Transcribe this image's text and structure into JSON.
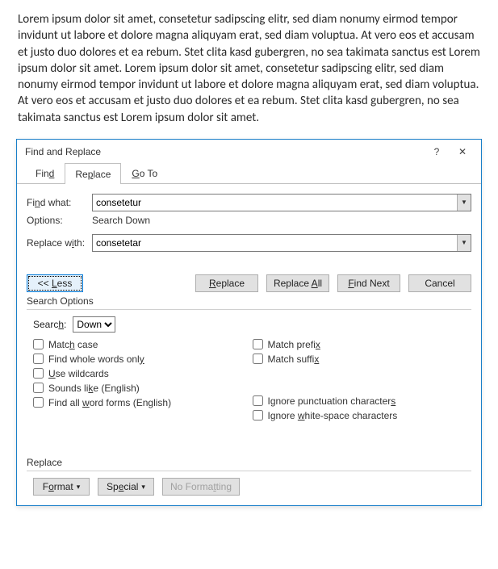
{
  "document": {
    "text": "Lorem ipsum dolor sit amet, consetetur sadipscing elitr, sed diam nonumy eirmod tempor invidunt ut labore et dolore magna aliquyam erat, sed diam voluptua. At vero eos et accusam et justo duo dolores et ea rebum. Stet clita kasd gubergren, no sea takimata sanctus est Lorem ipsum dolor sit amet. Lorem ipsum dolor sit amet, consetetur sadipscing elitr, sed diam nonumy eirmod tempor invidunt ut labore et dolore magna aliquyam erat, sed diam voluptua. At vero eos et accusam et justo duo dolores et ea rebum. Stet clita kasd gubergren, no sea takimata sanctus est Lorem ipsum dolor sit amet."
  },
  "dialog": {
    "title": "Find and Replace",
    "help_symbol": "?",
    "close_symbol": "✕",
    "tabs": {
      "find": "Find",
      "replace": "Replace",
      "goto": "Go To"
    },
    "find_what_label": "Find what:",
    "find_what_value": "consetetur",
    "options_label": "Options:",
    "options_value": "Search Down",
    "replace_with_label": "Replace with:",
    "replace_with_value": "consetetar",
    "buttons": {
      "less": "<< Less",
      "replace": "Replace",
      "replace_all": "Replace All",
      "find_next": "Find Next",
      "cancel": "Cancel"
    },
    "search_options_heading": "Search Options",
    "search_label": "Search:",
    "search_direction": "Down",
    "checks_left": {
      "match_case": "Match case",
      "whole_words": "Find whole words only",
      "wildcards": "Use wildcards",
      "sounds_like": "Sounds like (English)",
      "word_forms": "Find all word forms (English)"
    },
    "checks_right": {
      "match_prefix": "Match prefix",
      "match_suffix": "Match suffix",
      "ignore_punct": "Ignore punctuation characters",
      "ignore_ws": "Ignore white-space characters"
    },
    "replace_heading": "Replace",
    "bottom_buttons": {
      "format": "Format",
      "special": "Special",
      "no_formatting": "No Formatting"
    }
  }
}
